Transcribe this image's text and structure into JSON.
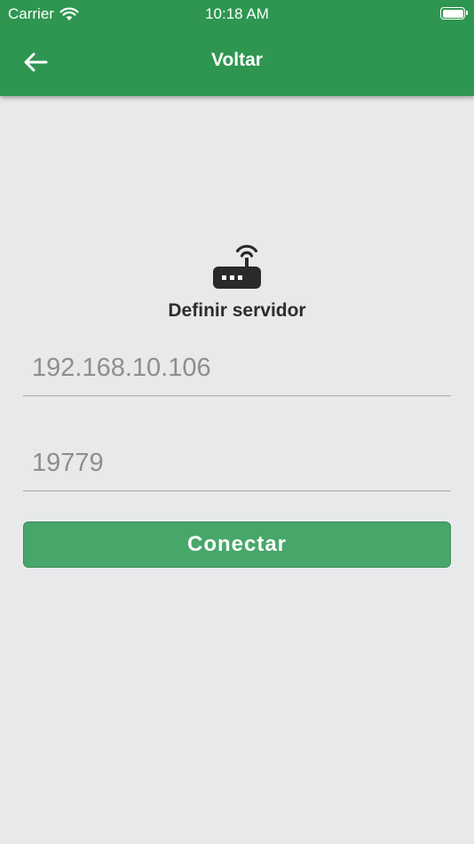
{
  "status_bar": {
    "carrier": "Carrier",
    "time": "10:18 AM",
    "wifi_icon": "wifi-icon",
    "battery_icon": "battery-icon"
  },
  "nav": {
    "back_icon": "arrow-left-icon",
    "title": "Voltar"
  },
  "server_form": {
    "icon": "router-icon",
    "title": "Definir servidor",
    "ip_field": {
      "value": "192.168.10.106"
    },
    "port_field": {
      "value": "19779"
    },
    "connect_label": "Conectar"
  },
  "colors": {
    "header": "#2e9650",
    "background": "#e8e9eb",
    "button": "#47a76a",
    "field_text": "#8e8e8e",
    "title_text": "#2d2d2d"
  }
}
